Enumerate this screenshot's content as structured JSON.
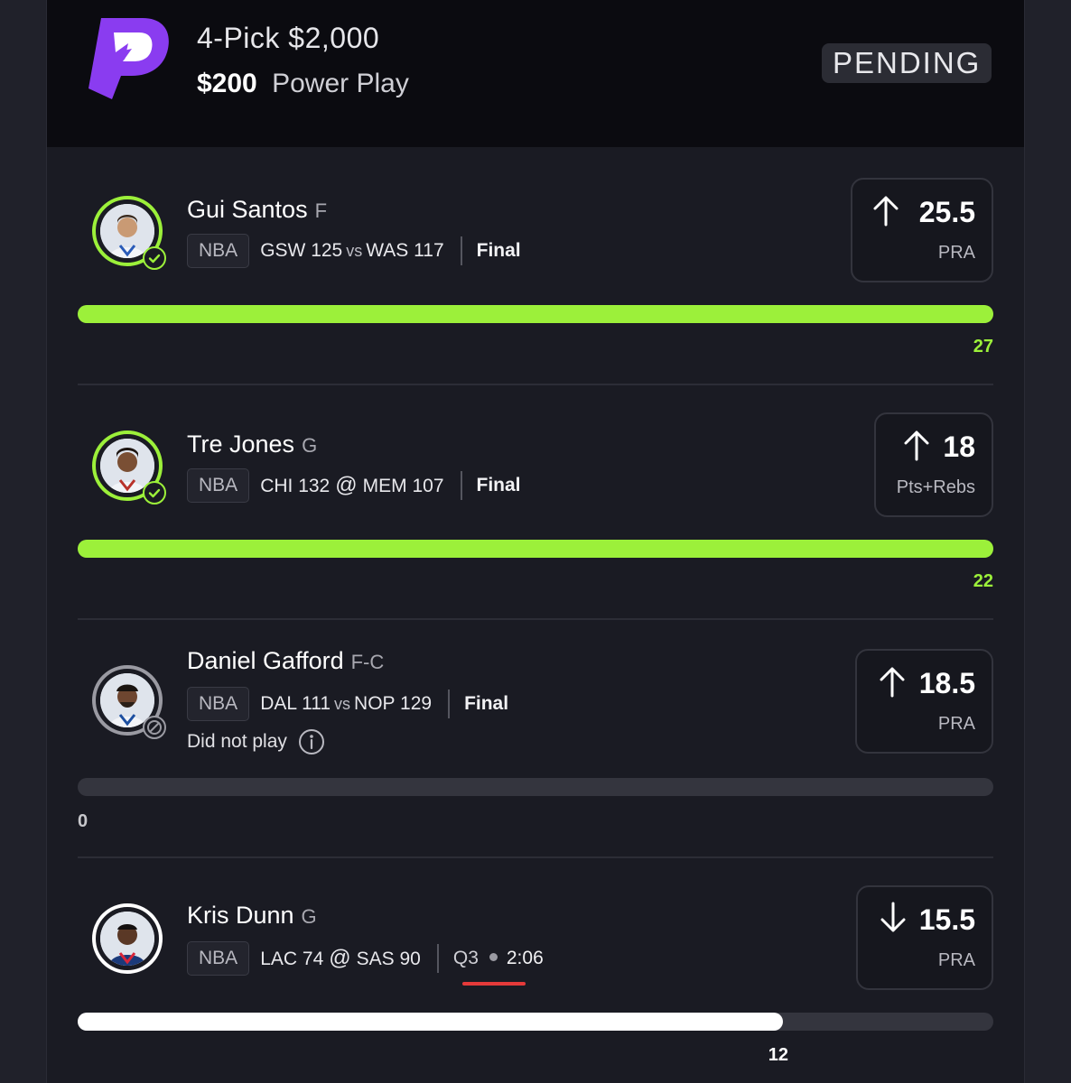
{
  "header": {
    "title": "4-Pick $2,000",
    "entry_amount": "$200",
    "entry_type": "Power Play",
    "status": "PENDING",
    "logo_icon": "prizepicks-logo",
    "brand_color": "#8a3cf0"
  },
  "picks": [
    {
      "name": "Gui Santos",
      "position": "F",
      "league": "NBA",
      "team1": "GSW",
      "score1": "125",
      "connector": "vs",
      "team2": "WAS",
      "score2": "117",
      "game_status": "Final",
      "direction": "up",
      "line": "25.5",
      "stat": "PRA",
      "actual": "27",
      "progress": 1.0,
      "result": "hit"
    },
    {
      "name": "Tre Jones",
      "position": "G",
      "league": "NBA",
      "team1": "CHI",
      "score1": "132",
      "connector": "@",
      "team2": "MEM",
      "score2": "107",
      "game_status": "Final",
      "direction": "up",
      "line": "18",
      "stat": "Pts+Rebs",
      "actual": "22",
      "progress": 1.0,
      "result": "hit"
    },
    {
      "name": "Daniel Gafford",
      "position": "F-C",
      "league": "NBA",
      "team1": "DAL",
      "score1": "111",
      "connector": "vs",
      "team2": "NOP",
      "score2": "129",
      "game_status": "Final",
      "note": "Did not play",
      "direction": "up",
      "line": "18.5",
      "stat": "PRA",
      "actual": "0",
      "progress": 0.0,
      "result": "dnp"
    },
    {
      "name": "Kris Dunn",
      "position": "G",
      "league": "NBA",
      "team1": "LAC",
      "score1": "74",
      "connector": "@",
      "team2": "SAS",
      "score2": "90",
      "quarter": "Q3",
      "clock": "2:06",
      "direction": "down",
      "line": "15.5",
      "stat": "PRA",
      "actual": "12",
      "progress": 0.77,
      "result": "live"
    }
  ],
  "colors": {
    "hit": "#9cf03a",
    "live_bar": "#ffffff",
    "dnp": "#9a9aa2",
    "live_indicator": "#e53a3a"
  }
}
